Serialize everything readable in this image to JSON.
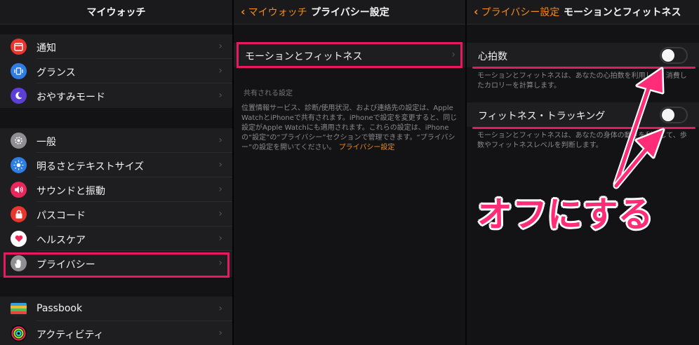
{
  "panel1": {
    "title": "マイウォッチ",
    "group1": [
      {
        "label": "通知",
        "icon": "notification-icon",
        "color": "#e8362f"
      },
      {
        "label": "グランス",
        "icon": "glance-icon",
        "color": "#2f7de1"
      },
      {
        "label": "おやすみモード",
        "icon": "moon-icon",
        "color": "#5b3fd6"
      }
    ],
    "group2": [
      {
        "label": "一般",
        "icon": "gear-icon",
        "color": "#8e8e93"
      },
      {
        "label": "明るさとテキストサイズ",
        "icon": "brightness-icon",
        "color": "#2f7de1"
      },
      {
        "label": "サウンドと振動",
        "icon": "sound-icon",
        "color": "#e8285a"
      },
      {
        "label": "パスコード",
        "icon": "lock-icon",
        "color": "#e8362f"
      },
      {
        "label": "ヘルスケア",
        "icon": "heart-icon",
        "color": "#ffffff"
      },
      {
        "label": "プライバシー",
        "icon": "hand-icon",
        "color": "#8e8e93"
      }
    ],
    "group3": [
      {
        "label": "Passbook",
        "icon": "passbook-icon",
        "color": "#222222"
      },
      {
        "label": "アクティビティ",
        "icon": "activity-icon",
        "color": "#000000"
      }
    ]
  },
  "panel2": {
    "back_label": "マイウォッチ",
    "title": "プライバシー設定",
    "row_label": "モーションとフィットネス",
    "section_header": "共有される設定",
    "footer_text": "位置情報サービス、診断/使用状況、および連絡先の設定は、Apple WatchとiPhoneで共有されます。iPhoneで設定を変更すると、同じ設定がApple Watchにも適用されます。これらの設定は、iPhoneの“設定”の“プライバシー”セクションで管理できます。“プライバシー”の設定を開いてください。",
    "footer_link": "プライバシー設定"
  },
  "panel3": {
    "back_label": "プライバシー設定",
    "title": "モーションとフィットネス",
    "heart_rate_label": "心拍数",
    "heart_rate_footer": "モーションとフィットネスは、あなたの心拍数を利用して、消費したカロリーを計算します。",
    "fitness_label": "フィットネス・トラッキング",
    "fitness_footer": "モーションとフィットネスは、あなたの身体の動きを利用して、歩数やフィットネスレベルを判断します。"
  },
  "annotation": "オフにする",
  "colors": {
    "accent": "#f08a1e",
    "highlight": "#e8195e",
    "annotation": "#ff2d78"
  }
}
